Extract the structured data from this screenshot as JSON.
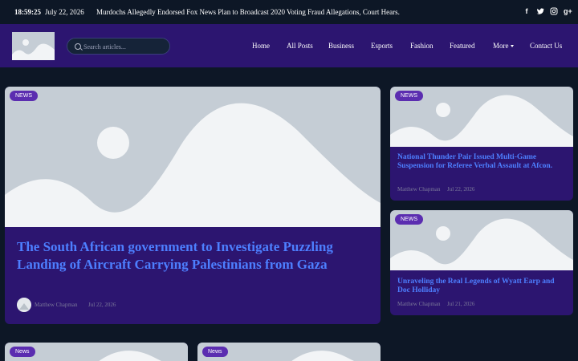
{
  "topbar": {
    "time": "18:59:25",
    "date": "July 22, 2026",
    "ticker": "Murdochs Allegedly Endorsed Fox News Plan to Broadcast 2020 Voting Fraud Allegations, Court Hears.",
    "social": [
      {
        "icon": "facebook-icon",
        "glyph": "f"
      },
      {
        "icon": "twitter-icon",
        "glyph": "t"
      },
      {
        "icon": "instagram-icon",
        "glyph": "◎"
      },
      {
        "icon": "google-plus-icon",
        "glyph": "g+"
      }
    ]
  },
  "header": {
    "search_placeholder": "Search articles...",
    "nav": {
      "home": "Home",
      "all_posts": "All Posts",
      "business": "Business",
      "esports": "Esports",
      "fashion": "Fashion",
      "featured": "Featured",
      "more": "More",
      "contact": "Contact Us"
    }
  },
  "featured": {
    "badge": "NEWS",
    "title": "The South African government to Investigate Puzzling Landing of Aircraft Carrying Palestinians from Gaza",
    "author": "Matthew Chapman",
    "date": "Jul 22, 2026"
  },
  "side_posts": [
    {
      "badge": "NEWS",
      "title": "National Thunder Pair Issued Multi-Game Suspension for Referee Verbal Assault at Afcon.",
      "author": "Matthew Chapman",
      "date": "Jul 22, 2026"
    },
    {
      "badge": "NEWS",
      "title": "Unraveling the Real Legends of Wyatt Earp and Doc Holliday",
      "author": "Matthew Chapman",
      "date": "Jul 21, 2026"
    }
  ],
  "bottom_posts": [
    {
      "badge": "News"
    },
    {
      "badge": "News"
    }
  ],
  "colors": {
    "background": "#0d1726",
    "header": "#2c1570",
    "card": "#2c1570",
    "title_link": "#4d7fff",
    "badge": "#5b2db0",
    "placeholder_bg": "#c5cdd5",
    "placeholder_fg": "#f2f4f6"
  }
}
